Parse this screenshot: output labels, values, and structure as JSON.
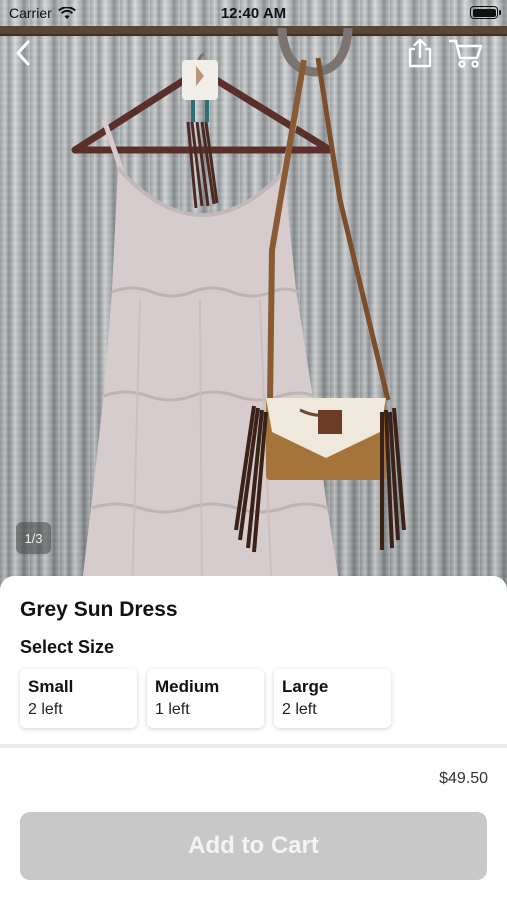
{
  "status_bar": {
    "carrier": "Carrier",
    "time": "12:40 AM"
  },
  "product": {
    "image_counter": "1/3",
    "title": "Grey Sun Dress",
    "select_size_label": "Select Size",
    "sizes": [
      {
        "name": "Small",
        "stock": "2 left"
      },
      {
        "name": "Medium",
        "stock": "1 left"
      },
      {
        "name": "Large",
        "stock": "2 left"
      }
    ],
    "price": "$49.50",
    "add_to_cart_label": "Add to Cart"
  },
  "icons": {
    "back": "chevron-left-icon",
    "share": "share-icon",
    "cart": "cart-icon",
    "wifi": "wifi-icon",
    "battery": "battery-icon"
  },
  "colors": {
    "button_disabled": "#c8c8c8",
    "button_text": "#f4f4f4",
    "dress": "#d6cccd",
    "bag_leather": "#a4743a"
  }
}
